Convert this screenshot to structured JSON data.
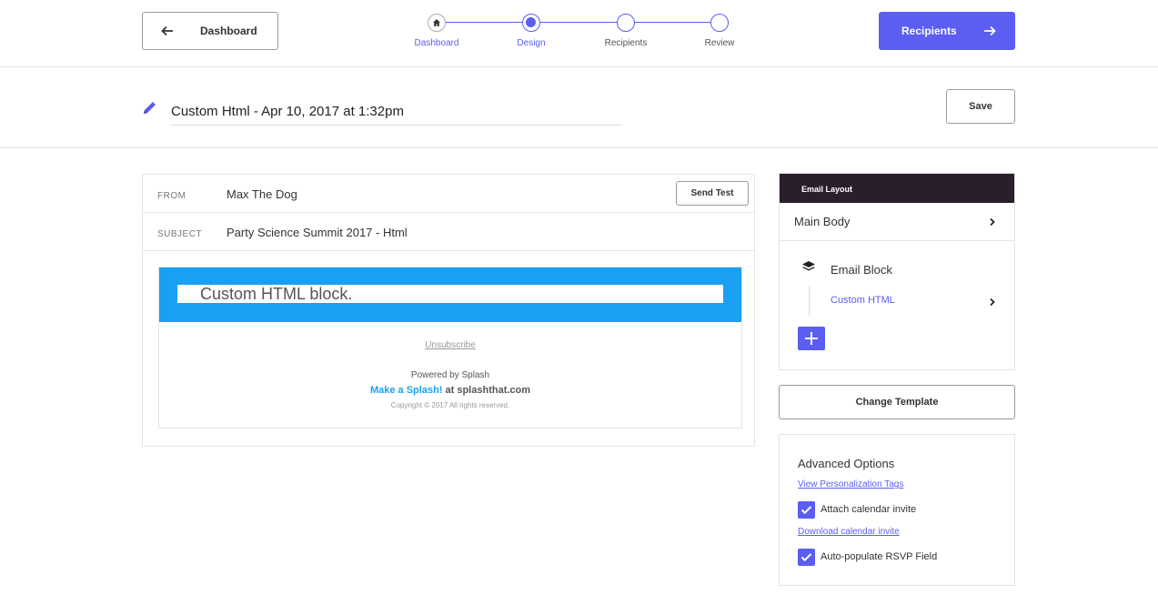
{
  "header": {
    "back_label": "Dashboard",
    "next_label": "Recipients",
    "steps": [
      {
        "label": "Dashboard"
      },
      {
        "label": "Design"
      },
      {
        "label": "Recipients"
      },
      {
        "label": "Review"
      }
    ],
    "accent": "#5b5ef0"
  },
  "title": {
    "value": "Custom Html - Apr 10, 2017 at 1:32pm",
    "save_label": "Save"
  },
  "email": {
    "from_key": "FROM",
    "from_value": "Max The Dog",
    "send_test_label": "Send Test",
    "subject_key": "SUBJECT",
    "subject_value": "Party Science Summit 2017 - Html",
    "preview": {
      "block_text": "Custom HTML block.",
      "unsubscribe": "Unsubscribe",
      "powered": "Powered by Splash",
      "make_a_splash": "Make a Splash!",
      "at_site": " at splashthat.com",
      "copyright": "Copyright © 2017 All rights reserved.",
      "banner_color": "#1aa0f3"
    }
  },
  "layout": {
    "header": "Email Layout",
    "main_body": "Main Body",
    "email_block": "Email Block",
    "custom_html": "Custom HTML"
  },
  "change_template_label": "Change Template",
  "advanced": {
    "title": "Advanced Options",
    "view_tags_link": "View Personalization Tags",
    "attach_calendar": "Attach calendar invite",
    "download_calendar_link": "Download calendar invite",
    "auto_rsvp": "Auto-populate RSVP Field"
  }
}
